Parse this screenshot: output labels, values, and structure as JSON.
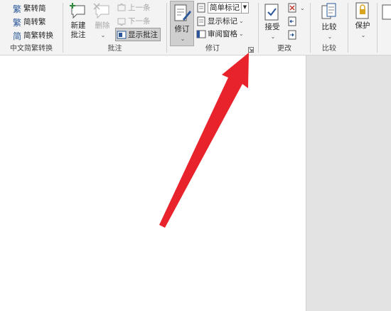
{
  "ribbon": {
    "chinese_conversion": {
      "label": "中文简繁转换",
      "items": [
        "繁转简",
        "简转繁",
        "简繁转换"
      ]
    },
    "comments": {
      "label": "批注",
      "new_comment": [
        "新建",
        "批注"
      ],
      "delete": "删除",
      "previous": "上一条",
      "next": "下一条",
      "show_comments": "显示批注"
    },
    "tracking": {
      "label": "修订",
      "track_changes": "修订",
      "markup_mode": "简单标记",
      "show_markup": "显示标记",
      "reviewing_pane": "审阅窗格"
    },
    "changes": {
      "label": "更改",
      "accept": "接受"
    },
    "compare": {
      "label": "比较",
      "compare": "比较"
    },
    "protect": {
      "protect": "保护"
    }
  },
  "colors": {
    "arrow": "#e8232b",
    "ribbon_bg": "#f3f3f3",
    "doc_bg": "#ffffff",
    "side_bg": "#e3e3e3",
    "accent": "#2b579a"
  }
}
